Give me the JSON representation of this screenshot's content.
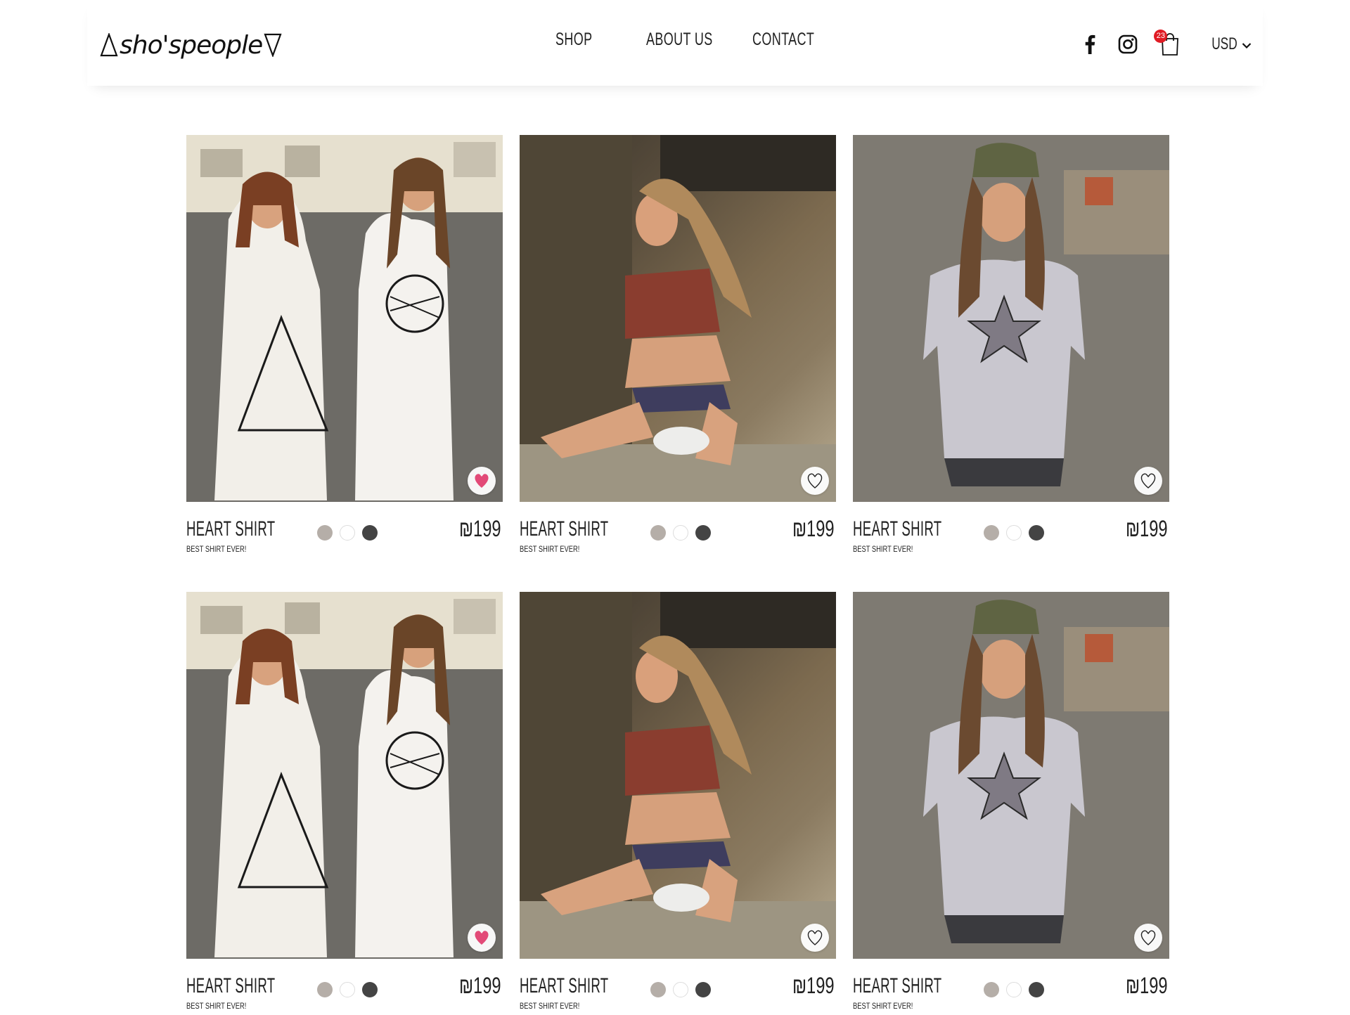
{
  "header": {
    "logo_text": "sho'speople",
    "nav": [
      {
        "label": "SHOP"
      },
      {
        "label": "ABOUT US"
      },
      {
        "label": "CONTACT"
      }
    ],
    "cart_count": "23",
    "currency": "USD"
  },
  "colors": {
    "badge": "#e01b24",
    "wishlist_active": "#e24a78",
    "swatch_grey": "#b5aea8",
    "swatch_white": "#ffffff",
    "swatch_dark": "#444444"
  },
  "products": [
    {
      "name": "HEART SHIRT",
      "subtitle": "BEST SHIRT EVER!",
      "price": "₪199",
      "photo": "two women in white graphic t-shirt dresses on street",
      "wishlisted": true
    },
    {
      "name": "HEART SHIRT",
      "subtitle": "BEST SHIRT EVER!",
      "price": "₪199",
      "photo": "woman in red crop top sitting on concrete block",
      "wishlisted": false
    },
    {
      "name": "HEART SHIRT",
      "subtitle": "BEST SHIRT EVER!",
      "price": "₪199",
      "photo": "woman in cap and grey star t-shirt on street",
      "wishlisted": false
    },
    {
      "name": "HEART SHIRT",
      "subtitle": "BEST SHIRT EVER!",
      "price": "₪199",
      "photo": "two women in white graphic t-shirt dresses on street",
      "wishlisted": true
    },
    {
      "name": "HEART SHIRT",
      "subtitle": "BEST SHIRT EVER!",
      "price": "₪199",
      "photo": "woman in red crop top sitting on concrete block",
      "wishlisted": false
    },
    {
      "name": "HEART SHIRT",
      "subtitle": "BEST SHIRT EVER!",
      "price": "₪199",
      "photo": "woman in cap and grey star t-shirt on street",
      "wishlisted": false
    }
  ]
}
